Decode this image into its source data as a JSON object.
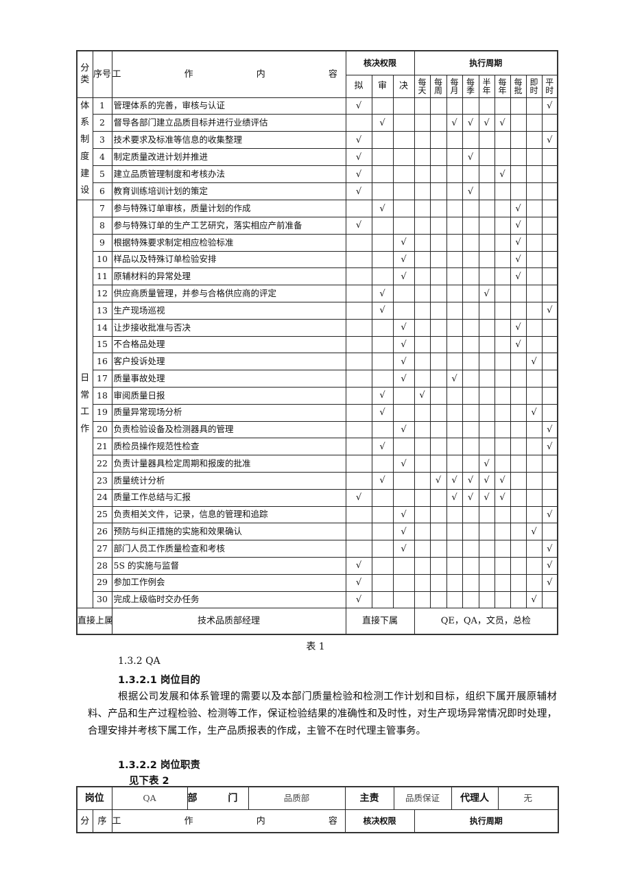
{
  "table1": {
    "header": {
      "category": "分类",
      "seq": "序号",
      "content": "工 作 内 容",
      "authority": "核决权限",
      "cycle": "执行周期",
      "authority_cols": [
        "拟",
        "审",
        "决"
      ],
      "cycle_cols": [
        "每天",
        "每周",
        "每月",
        "每季",
        "半年",
        "每年",
        "每批",
        "即时",
        "平时"
      ]
    },
    "categories": [
      {
        "label": "体系制度建设",
        "rows": 6
      },
      {
        "label": "日常工作",
        "rows": 24
      }
    ],
    "check_mark": "√",
    "rows": [
      {
        "no": "1",
        "content": "管理体系的完善，审核与认证",
        "checks": [
          "拟",
          "平时"
        ]
      },
      {
        "no": "2",
        "content": "督导各部门建立品质目标并进行业绩评估",
        "checks": [
          "审",
          "每月",
          "每季",
          "半年",
          "每年"
        ]
      },
      {
        "no": "3",
        "content": "技术要求及标准等信息的收集整理",
        "checks": [
          "拟",
          "平时"
        ]
      },
      {
        "no": "4",
        "content": "制定质量改进计划并推进",
        "checks": [
          "拟",
          "每季"
        ]
      },
      {
        "no": "5",
        "content": "建立品质管理制度和考核办法",
        "checks": [
          "拟",
          "每年"
        ]
      },
      {
        "no": "6",
        "content": "教育训练培训计划的策定",
        "checks": [
          "拟",
          "每季"
        ]
      },
      {
        "no": "7",
        "content": "参与特殊订单审核，质量计划的作成",
        "checks": [
          "审",
          "每批"
        ]
      },
      {
        "no": "8",
        "content": "参与特殊订单的生产工艺研究，落实相应产前准备",
        "checks": [
          "拟",
          "每批"
        ]
      },
      {
        "no": "9",
        "content": "根据特殊要求制定相应检验标准",
        "checks": [
          "决",
          "每批"
        ]
      },
      {
        "no": "10",
        "content": "样品以及特殊订单检验安排",
        "checks": [
          "决",
          "每批"
        ]
      },
      {
        "no": "11",
        "content": "原辅材料的异常处理",
        "checks": [
          "决",
          "每批"
        ]
      },
      {
        "no": "12",
        "content": "供应商质量管理，并参与合格供应商的评定",
        "checks": [
          "审",
          "半年"
        ]
      },
      {
        "no": "13",
        "content": "生产现场巡视",
        "checks": [
          "审",
          "平时"
        ]
      },
      {
        "no": "14",
        "content": "让步接收批准与否决",
        "checks": [
          "决",
          "每批"
        ]
      },
      {
        "no": "15",
        "content": "不合格品处理",
        "checks": [
          "决",
          "每批"
        ]
      },
      {
        "no": "16",
        "content": "客户投诉处理",
        "checks": [
          "决",
          "即时"
        ]
      },
      {
        "no": "17",
        "content": "质量事故处理",
        "checks": [
          "决",
          "每月"
        ]
      },
      {
        "no": "18",
        "content": "审阅质量日报",
        "checks": [
          "审",
          "每天"
        ]
      },
      {
        "no": "19",
        "content": "质量异常现场分析",
        "checks": [
          "审",
          "即时"
        ]
      },
      {
        "no": "20",
        "content": "负责检验设备及检测器具的管理",
        "checks": [
          "决",
          "平时"
        ]
      },
      {
        "no": "21",
        "content": "质检员操作规范性检查",
        "checks": [
          "审",
          "平时"
        ]
      },
      {
        "no": "22",
        "content": "负责计量器具检定周期和报废的批准",
        "checks": [
          "决",
          "半年"
        ]
      },
      {
        "no": "23",
        "content": "质量统计分析",
        "checks": [
          "审",
          "每周",
          "每月",
          "每季",
          "半年",
          "每年"
        ]
      },
      {
        "no": "24",
        "content": "质量工作总结与汇报",
        "checks": [
          "拟",
          "每月",
          "每季",
          "半年",
          "每年"
        ]
      },
      {
        "no": "25",
        "content": "负责相关文件，记录，信息的管理和追踪",
        "checks": [
          "决",
          "平时"
        ]
      },
      {
        "no": "26",
        "content": "预防与纠正措施的实施和效果确认",
        "checks": [
          "决",
          "即时"
        ]
      },
      {
        "no": "27",
        "content": "部门人员工作质量检查和考核",
        "checks": [
          "决",
          "平时"
        ]
      },
      {
        "no": "28",
        "content": "5S 的实施与监督",
        "checks": [
          "拟",
          "平时"
        ]
      },
      {
        "no": "29",
        "content": "参加工作例会",
        "checks": [
          "拟",
          "平时"
        ]
      },
      {
        "no": "30",
        "content": "完成上级临时交办任务",
        "checks": [
          "拟",
          "即时"
        ]
      }
    ],
    "footer": {
      "superior_label": "直接上属",
      "superior_value": "技术品质部经理",
      "subordinate_label": "直接下属",
      "subordinate_value": "QE，QA，文员，总检"
    },
    "caption": "表 1"
  },
  "section": {
    "heading_132": "1.3.2 QA",
    "heading_1321": "1.3.2.1 岗位目的",
    "purpose_text": "根据公司发展和体系管理的需要以及本部门质量检验和检测工作计划和目标，组织下属开展原辅材料、产品和生产过程检验、检测等工作，保证检验结果的准确性和及时性，对生产现场异常情况即时处理，合理安排并考核下属工作，生产品质报表的作成，主管不在时代理主管事务。",
    "heading_1322": "1.3.2.2 岗位职责",
    "see_table": "见下表 2"
  },
  "table2": {
    "position_label": "岗位",
    "position_value": "QA",
    "dept_label": "部 门",
    "dept_value": "品质部",
    "duty_label": "主责",
    "duty_value": "品质保证",
    "agent_label": "代理人",
    "agent_value": "无",
    "hdr_category": "分",
    "hdr_seq": "序",
    "hdr_content": "工 作 内 容",
    "hdr_authority": "核决权限",
    "hdr_cycle": "执行周期"
  }
}
